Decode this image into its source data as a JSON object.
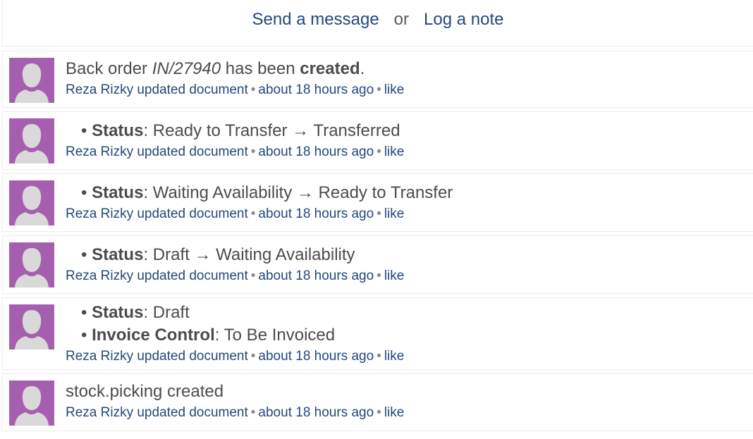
{
  "compose": {
    "send_message": "Send a message",
    "or": "or",
    "log_note": "Log a note"
  },
  "messages": [
    {
      "kind": "backorder",
      "prefix": "Back order ",
      "ref": "IN/27940",
      "middle": " has been ",
      "action": "created",
      "suffix": ".",
      "author": "Reza Rizky",
      "action_text": "updated document",
      "time": "about 18 hours ago",
      "like": "like"
    },
    {
      "kind": "tracking",
      "lines": [
        {
          "field": "Status",
          "value": ": Ready to Transfer → Transferred"
        }
      ],
      "author": "Reza Rizky",
      "action_text": "updated document",
      "time": "about 18 hours ago",
      "like": "like"
    },
    {
      "kind": "tracking",
      "lines": [
        {
          "field": "Status",
          "value": ": Waiting Availability → Ready to Transfer"
        }
      ],
      "author": "Reza Rizky",
      "action_text": "updated document",
      "time": "about 18 hours ago",
      "like": "like"
    },
    {
      "kind": "tracking",
      "lines": [
        {
          "field": "Status",
          "value": ": Draft → Waiting Availability"
        }
      ],
      "author": "Reza Rizky",
      "action_text": "updated document",
      "time": "about 18 hours ago",
      "like": "like"
    },
    {
      "kind": "tracking",
      "lines": [
        {
          "field": "Status",
          "value": ": Draft"
        },
        {
          "field": "Invoice Control",
          "value": ": To Be Invoiced"
        }
      ],
      "author": "Reza Rizky",
      "action_text": "updated document",
      "time": "about 18 hours ago",
      "like": "like"
    },
    {
      "kind": "plain",
      "text": "stock.picking created",
      "author": "Reza Rizky",
      "action_text": "updated document",
      "time": "about 18 hours ago",
      "like": "like"
    }
  ],
  "bullet": "•",
  "separator": "•",
  "colors": {
    "avatar_bg": "#a65fae",
    "link": "#24487b",
    "text": "#4c4c4c",
    "border": "#ececec"
  }
}
